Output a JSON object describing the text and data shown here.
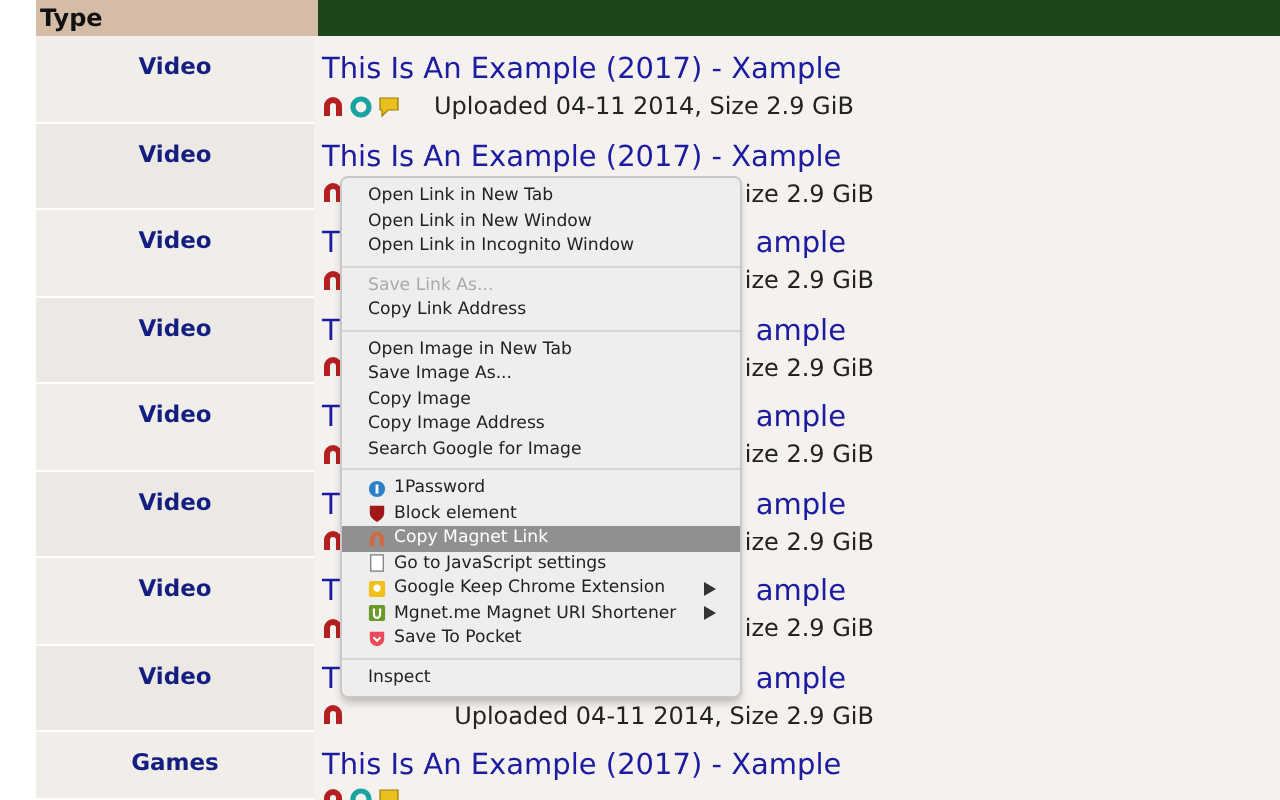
{
  "table": {
    "columns": [
      {
        "label": "Type"
      }
    ],
    "rows": [
      {
        "kind": "full",
        "type": "Video",
        "title": "This Is An Example (2017) - Xample",
        "info": "Uploaded 04-11 2014, Size 2.9 GiB"
      },
      {
        "kind": "full",
        "type": "Video",
        "title": "This Is An Example (2017) - Xample",
        "info": "ize 2.9 GiB"
      },
      {
        "kind": "covered",
        "type": "Video",
        "title": "T",
        "title_end": "ample",
        "info": "ize 2.9 GiB"
      },
      {
        "kind": "covered",
        "type": "Video",
        "title": "T",
        "title_end": "ample",
        "info": "ize 2.9 GiB"
      },
      {
        "kind": "covered",
        "type": "Video",
        "title": "T",
        "title_end": "ample",
        "info": "ize 2.9 GiB"
      },
      {
        "kind": "covered",
        "type": "Video",
        "title": "T",
        "title_end": "ample",
        "info": "ize 2.9 GiB"
      },
      {
        "kind": "covered",
        "type": "Video",
        "title": "T",
        "title_end": "ample",
        "info": "ize 2.9 GiB"
      },
      {
        "kind": "covered",
        "type": "Video",
        "title": "T",
        "title_end": "ample",
        "info": "Uploaded 04-11 2014, Size 2.9 GiB"
      },
      {
        "kind": "full",
        "type": "Games",
        "title": "This Is An Example (2017) - Xample"
      }
    ]
  },
  "context_menu": {
    "sections": [
      [
        {
          "label": "Open Link in New Tab",
          "disabled": false,
          "selected": false,
          "submenu": false
        },
        {
          "label": "Open Link in New Window",
          "disabled": false,
          "selected": false,
          "submenu": false
        },
        {
          "label": "Open Link in Incognito Window",
          "disabled": false,
          "selected": false,
          "submenu": false
        }
      ],
      [
        {
          "label": "Save Link As...",
          "disabled": true,
          "selected": false,
          "submenu": false
        },
        {
          "label": "Copy Link Address",
          "disabled": false,
          "selected": false,
          "submenu": false
        }
      ],
      [
        {
          "label": "Open Image in New Tab",
          "disabled": false,
          "selected": false,
          "submenu": false
        },
        {
          "label": "Save Image As...",
          "disabled": false,
          "selected": false,
          "submenu": false
        },
        {
          "label": "Copy Image",
          "disabled": false,
          "selected": false,
          "submenu": false
        },
        {
          "label": "Copy Image Address",
          "disabled": false,
          "selected": false,
          "submenu": false
        },
        {
          "label": "Search Google for Image",
          "disabled": false,
          "selected": false,
          "submenu": false
        }
      ],
      [
        {
          "label": "1Password",
          "disabled": false,
          "selected": false,
          "submenu": false
        },
        {
          "label": "Block element",
          "disabled": false,
          "selected": false,
          "submenu": false
        },
        {
          "label": "Copy Magnet Link",
          "disabled": false,
          "selected": true,
          "submenu": false
        },
        {
          "label": "Go to JavaScript settings",
          "disabled": false,
          "selected": false,
          "submenu": false
        },
        {
          "label": "Google Keep Chrome Extension",
          "disabled": false,
          "selected": false,
          "submenu": true
        },
        {
          "label": "Mgnet.me Magnet URI Shortener",
          "disabled": false,
          "selected": false,
          "submenu": true
        },
        {
          "label": "Save To Pocket",
          "disabled": false,
          "selected": false,
          "submenu": false
        }
      ],
      [
        {
          "label": "Inspect",
          "disabled": false,
          "selected": false,
          "submenu": false
        }
      ]
    ]
  }
}
